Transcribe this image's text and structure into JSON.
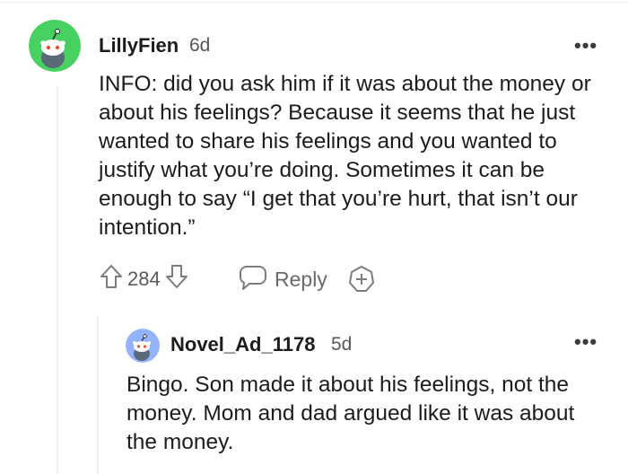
{
  "comments": [
    {
      "username": "LillyFien",
      "time": "6d",
      "text": "INFO: did you ask him if it was about the money or about his feelings? Because it seems that he just wanted to share his feelings and you wanted to justify what you’re doing. Sometimes it can be enough to say “I get that you’re hurt, that isn’t our intention.”",
      "votes": "284",
      "reply_label": "Reply",
      "more_label": "•••",
      "avatar_color": "#46d160"
    },
    {
      "username": "Novel_Ad_1178",
      "time": "5d",
      "text": "Bingo. Son made it about his feelings, not the money. Mom and dad argued like it was about the money.",
      "more_label": "•••",
      "avatar_color": "#94b3ff"
    }
  ],
  "icons": {
    "upvote": "arrow-up-icon",
    "downvote": "arrow-down-icon",
    "reply": "chat-bubble-icon",
    "award": "award-plus-icon",
    "more": "more-dots-icon"
  }
}
